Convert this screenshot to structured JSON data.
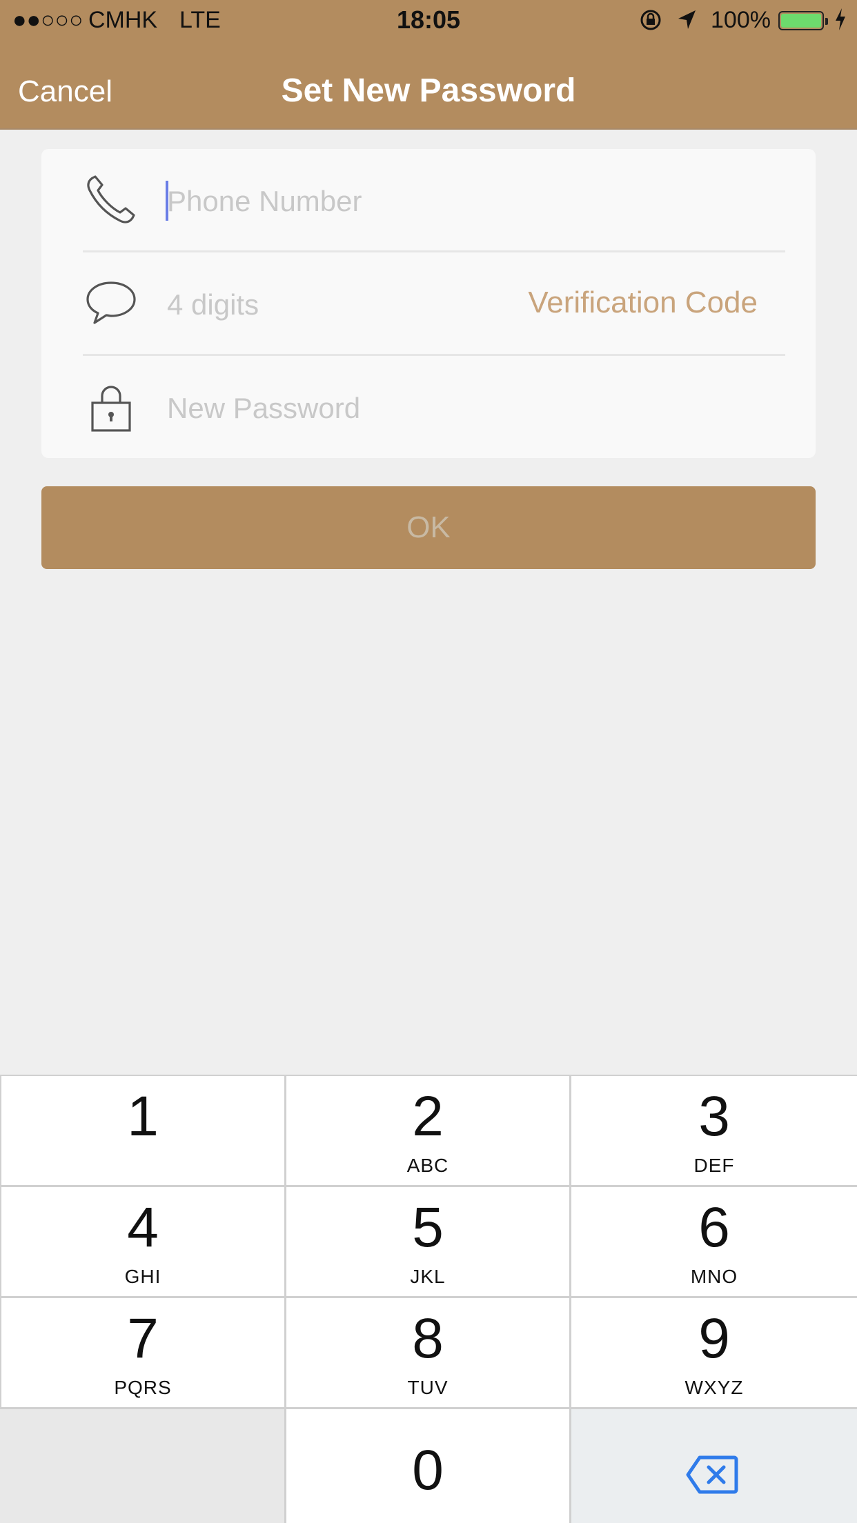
{
  "status_bar": {
    "signal": "●●○○○",
    "carrier": "CMHK",
    "network": "LTE",
    "time": "18:05",
    "battery_pct": "100%",
    "battery_level": 1.0
  },
  "header": {
    "cancel_label": "Cancel",
    "title": "Set New Password",
    "background_color": "#b38c5f"
  },
  "form": {
    "phone": {
      "placeholder": "Phone Number",
      "value": "",
      "icon": "phone-icon"
    },
    "code": {
      "placeholder": "4 digits",
      "value": "",
      "icon": "speech-bubble-icon",
      "verify_label": "Verification Code"
    },
    "password": {
      "placeholder": "New Password",
      "value": "",
      "icon": "lock-icon"
    }
  },
  "ok_button": {
    "label": "OK"
  },
  "keypad": {
    "keys": [
      {
        "num": "1",
        "letters": ""
      },
      {
        "num": "2",
        "letters": "ABC"
      },
      {
        "num": "3",
        "letters": "DEF"
      },
      {
        "num": "4",
        "letters": "GHI"
      },
      {
        "num": "5",
        "letters": "JKL"
      },
      {
        "num": "6",
        "letters": "MNO"
      },
      {
        "num": "7",
        "letters": "PQRS"
      },
      {
        "num": "8",
        "letters": "TUV"
      },
      {
        "num": "9",
        "letters": "WXYZ"
      }
    ],
    "zero": "0",
    "delete_icon": "backspace-icon",
    "accent_color": "#2f7bea"
  }
}
